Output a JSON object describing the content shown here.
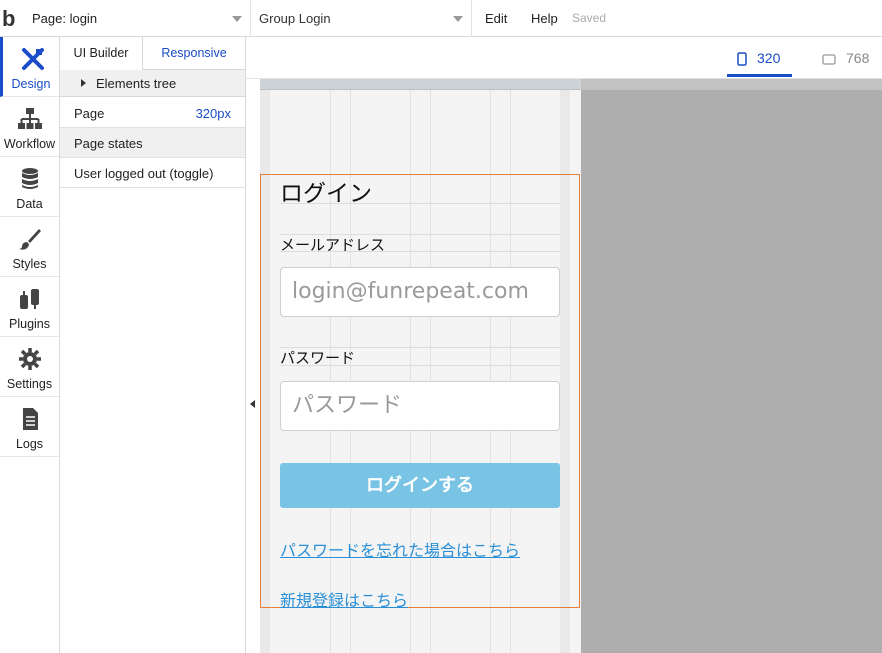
{
  "topbar": {
    "logo": "b",
    "page_select": "Page: login",
    "group_select": "Group Login",
    "menu_edit": "Edit",
    "menu_help": "Help",
    "status": "Saved"
  },
  "sidebar": {
    "items": [
      {
        "label": "Design",
        "icon": "design-icon",
        "active": true
      },
      {
        "label": "Workflow",
        "icon": "workflow-icon"
      },
      {
        "label": "Data",
        "icon": "database-icon"
      },
      {
        "label": "Styles",
        "icon": "brush-icon"
      },
      {
        "label": "Plugins",
        "icon": "plug-icon"
      },
      {
        "label": "Settings",
        "icon": "gear-icon"
      },
      {
        "label": "Logs",
        "icon": "document-icon"
      }
    ]
  },
  "panel": {
    "tab_ui_builder": "UI Builder",
    "tab_responsive": "Responsive",
    "elements_tree": "Elements tree",
    "page_label": "Page",
    "page_value": "320px",
    "page_states": "Page states",
    "state_item": "User logged out (toggle)"
  },
  "breakpoints": {
    "active": "320",
    "other": "768"
  },
  "login_page": {
    "title": "ログイン",
    "email_label": "メールアドレス",
    "email_placeholder": "login@funrepeat.com",
    "password_label": "パスワード",
    "password_placeholder": "パスワード",
    "login_button": "ログインする",
    "forgot_link": "パスワードを忘れた場合はこちら",
    "signup_link": "新規登録はこちら"
  },
  "colors": {
    "accent": "#1a4dc7",
    "button": "#79c4e5",
    "link": "#2a8fd6",
    "page_border": "#e4803a"
  }
}
